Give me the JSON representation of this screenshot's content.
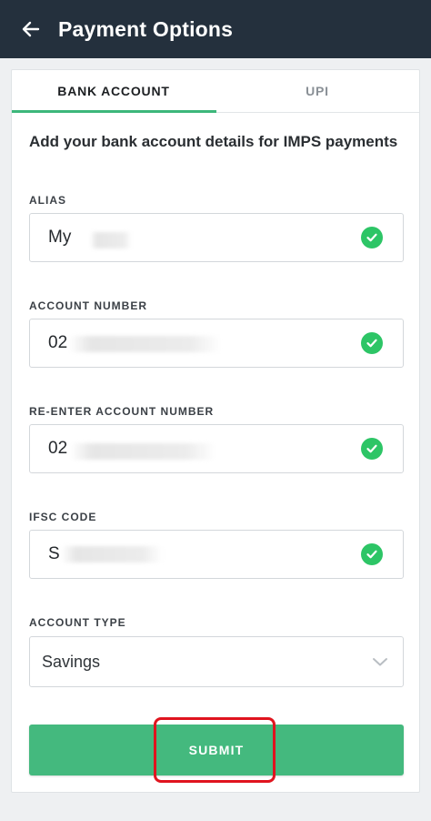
{
  "header": {
    "back_icon": "arrow-left-icon",
    "title": "Payment Options"
  },
  "tabs": [
    {
      "label": "BANK ACCOUNT",
      "active": true
    },
    {
      "label": "UPI",
      "active": false
    }
  ],
  "form": {
    "intro": "Add your bank account details for IMPS payments",
    "fields": [
      {
        "label": "ALIAS",
        "value": "My ",
        "valid": true
      },
      {
        "label": "ACCOUNT NUMBER",
        "value": "02",
        "valid": true
      },
      {
        "label": "RE-ENTER ACCOUNT NUMBER",
        "value": "02",
        "valid": true
      },
      {
        "label": "IFSC CODE",
        "value": "S",
        "valid": true
      }
    ],
    "account_type": {
      "label": "ACCOUNT TYPE",
      "selected": "Savings"
    },
    "submit_label": "SUBMIT"
  },
  "colors": {
    "header_bg": "#24303d",
    "accent": "#3db77b",
    "check": "#2dc566",
    "highlight": "#e0141e"
  }
}
